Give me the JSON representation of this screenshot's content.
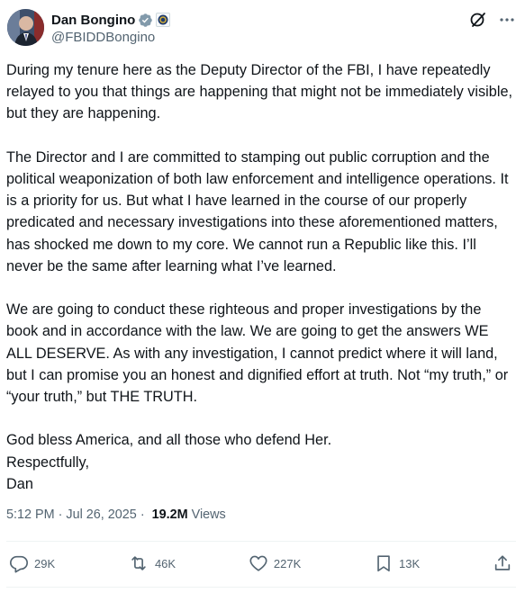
{
  "author": {
    "display_name": "Dan Bongino",
    "handle": "@FBIDDBongino",
    "verified_icon": "verified-badge-icon",
    "affiliation_icon": "fbi-seal-icon"
  },
  "header_icons": [
    "grok-icon",
    "more-options-icon"
  ],
  "tweet": {
    "text": "During my tenure here as the Deputy Director of the FBI, I have repeatedly relayed to you that things are happening that might not be immediately visible, but they are happening.\n\nThe Director and I are committed to stamping out public corruption and the political weaponization of both law enforcement and intelligence operations. It is a priority for us. But what I have learned in the course of our properly predicated and necessary investigations into these aforementioned matters, has shocked me down to my core. We cannot run a Republic like this. I’ll never be the same after learning what I’ve learned.\n\nWe are going to conduct these righteous and proper investigations by the book and in accordance with the law. We are going to get the answers WE ALL DESERVE. As with any investigation, I cannot predict where it will land, but I can promise you an honest and dignified effort at truth. Not “my truth,” or “your truth,” but THE TRUTH.\n\nGod bless America, and all those who defend Her.\nRespectfully,\nDan"
  },
  "meta": {
    "time": "5:12 PM",
    "separator": "·",
    "date": "Jul 26, 2025",
    "views_count": "19.2M",
    "views_label": "Views"
  },
  "actions": {
    "replies": "29K",
    "reposts": "46K",
    "likes": "227K",
    "bookmarks": "13K"
  },
  "colors": {
    "verified": "#1d9bf0",
    "secondary_text": "#536471",
    "primary_text": "#0f1419"
  }
}
